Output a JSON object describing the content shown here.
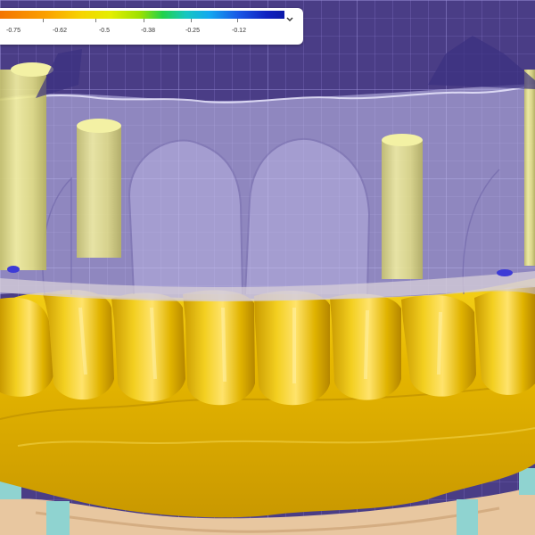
{
  "legend": {
    "ticks": [
      "-0.75",
      "-0.62",
      "-0.5",
      "-0.38",
      "-0.25",
      "-0.12"
    ],
    "toggle_icon": "chevron-down-icon"
  },
  "colors": {
    "background": "#4a3d86",
    "grid": "#7d6fc0",
    "restoration_shell": "#c9c4ef",
    "gingiva": "#e5b800",
    "implant_cylinders": "#f1ee8e",
    "soft_tissue": "#e8c7a0",
    "analogs": "#8fd3d0",
    "contact_marks": "#3d3bd6"
  }
}
